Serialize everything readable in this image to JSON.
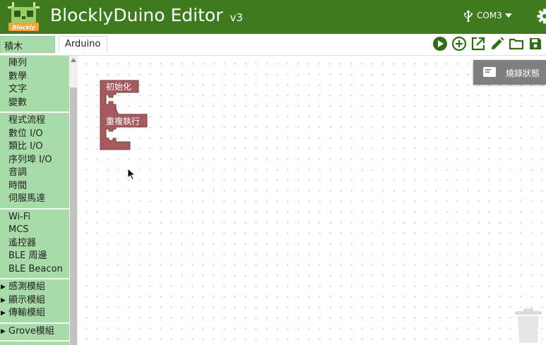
{
  "app": {
    "logo_text": "Blockly",
    "title": "BlocklyDuino Editor",
    "version": "v3",
    "port": "COM3"
  },
  "tabs": {
    "toolbox": "積木",
    "code": "Arduino"
  },
  "toolbar": {
    "icons": [
      "run-icon",
      "add-icon",
      "open-external-icon",
      "edit-icon",
      "folder-icon",
      "save-icon"
    ]
  },
  "sidebar": {
    "groups": [
      {
        "items": [
          {
            "label": "陣列"
          },
          {
            "label": "數學"
          },
          {
            "label": "文字"
          },
          {
            "label": "變數"
          }
        ]
      },
      {
        "items": [
          {
            "label": "程式流程"
          },
          {
            "label": "數位 I/O"
          },
          {
            "label": "類比 I/O"
          },
          {
            "label": "序列埠 I/O"
          },
          {
            "label": "音調"
          },
          {
            "label": "時間"
          },
          {
            "label": "伺服馬達"
          }
        ]
      },
      {
        "items": [
          {
            "label": "Wi-Fi"
          },
          {
            "label": "MCS"
          },
          {
            "label": "遙控器"
          },
          {
            "label": "BLE 周邊"
          },
          {
            "label": "BLE Beacon"
          }
        ]
      },
      {
        "items": [
          {
            "label": "感測模組",
            "expandable": true
          },
          {
            "label": "顯示模組",
            "expandable": true
          },
          {
            "label": "傳輸模組",
            "expandable": true
          }
        ]
      },
      {
        "items": [
          {
            "label": "Grove模組",
            "expandable": true
          }
        ]
      }
    ]
  },
  "workspace": {
    "status_button": "燒錄狀態",
    "blocks": {
      "setup": "初始化",
      "loop": "重複執行"
    }
  },
  "colors": {
    "header": "#3e7a1e",
    "sidebar": "#a7dba7",
    "block": "#a55b5e",
    "toolbar_icon": "#2f6e14"
  }
}
